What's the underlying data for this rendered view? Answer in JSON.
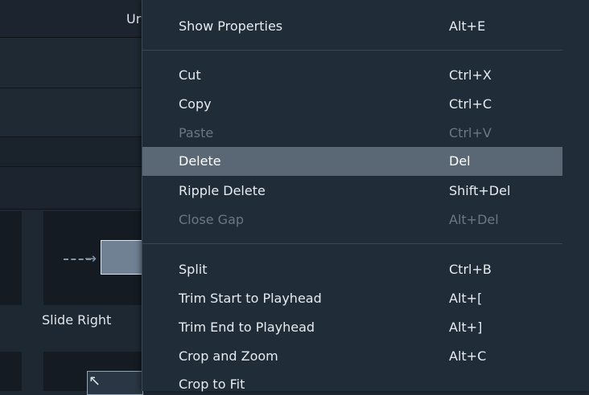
{
  "background": {
    "top_title_partial": "Ur",
    "tile_label": "Slide Right"
  },
  "menu": {
    "items": [
      {
        "label": "Show Properties",
        "shortcut": "Alt+E"
      },
      {
        "label": "Cut",
        "shortcut": "Ctrl+X"
      },
      {
        "label": "Copy",
        "shortcut": "Ctrl+C"
      },
      {
        "label": "Paste",
        "shortcut": "Ctrl+V"
      },
      {
        "label": "Delete",
        "shortcut": "Del"
      },
      {
        "label": "Ripple Delete",
        "shortcut": "Shift+Del"
      },
      {
        "label": "Close Gap",
        "shortcut": "Alt+Del"
      },
      {
        "label": "Split",
        "shortcut": "Ctrl+B"
      },
      {
        "label": "Trim Start to Playhead",
        "shortcut": "Alt+["
      },
      {
        "label": "Trim End to Playhead",
        "shortcut": "Alt+]"
      },
      {
        "label": "Crop and Zoom",
        "shortcut": "Alt+C"
      },
      {
        "label": "Crop to Fit",
        "shortcut": ""
      }
    ]
  },
  "colors": {
    "highlight": "#5a6775",
    "menu_bg": "#202c38",
    "disabled_text": "#6a7785"
  }
}
